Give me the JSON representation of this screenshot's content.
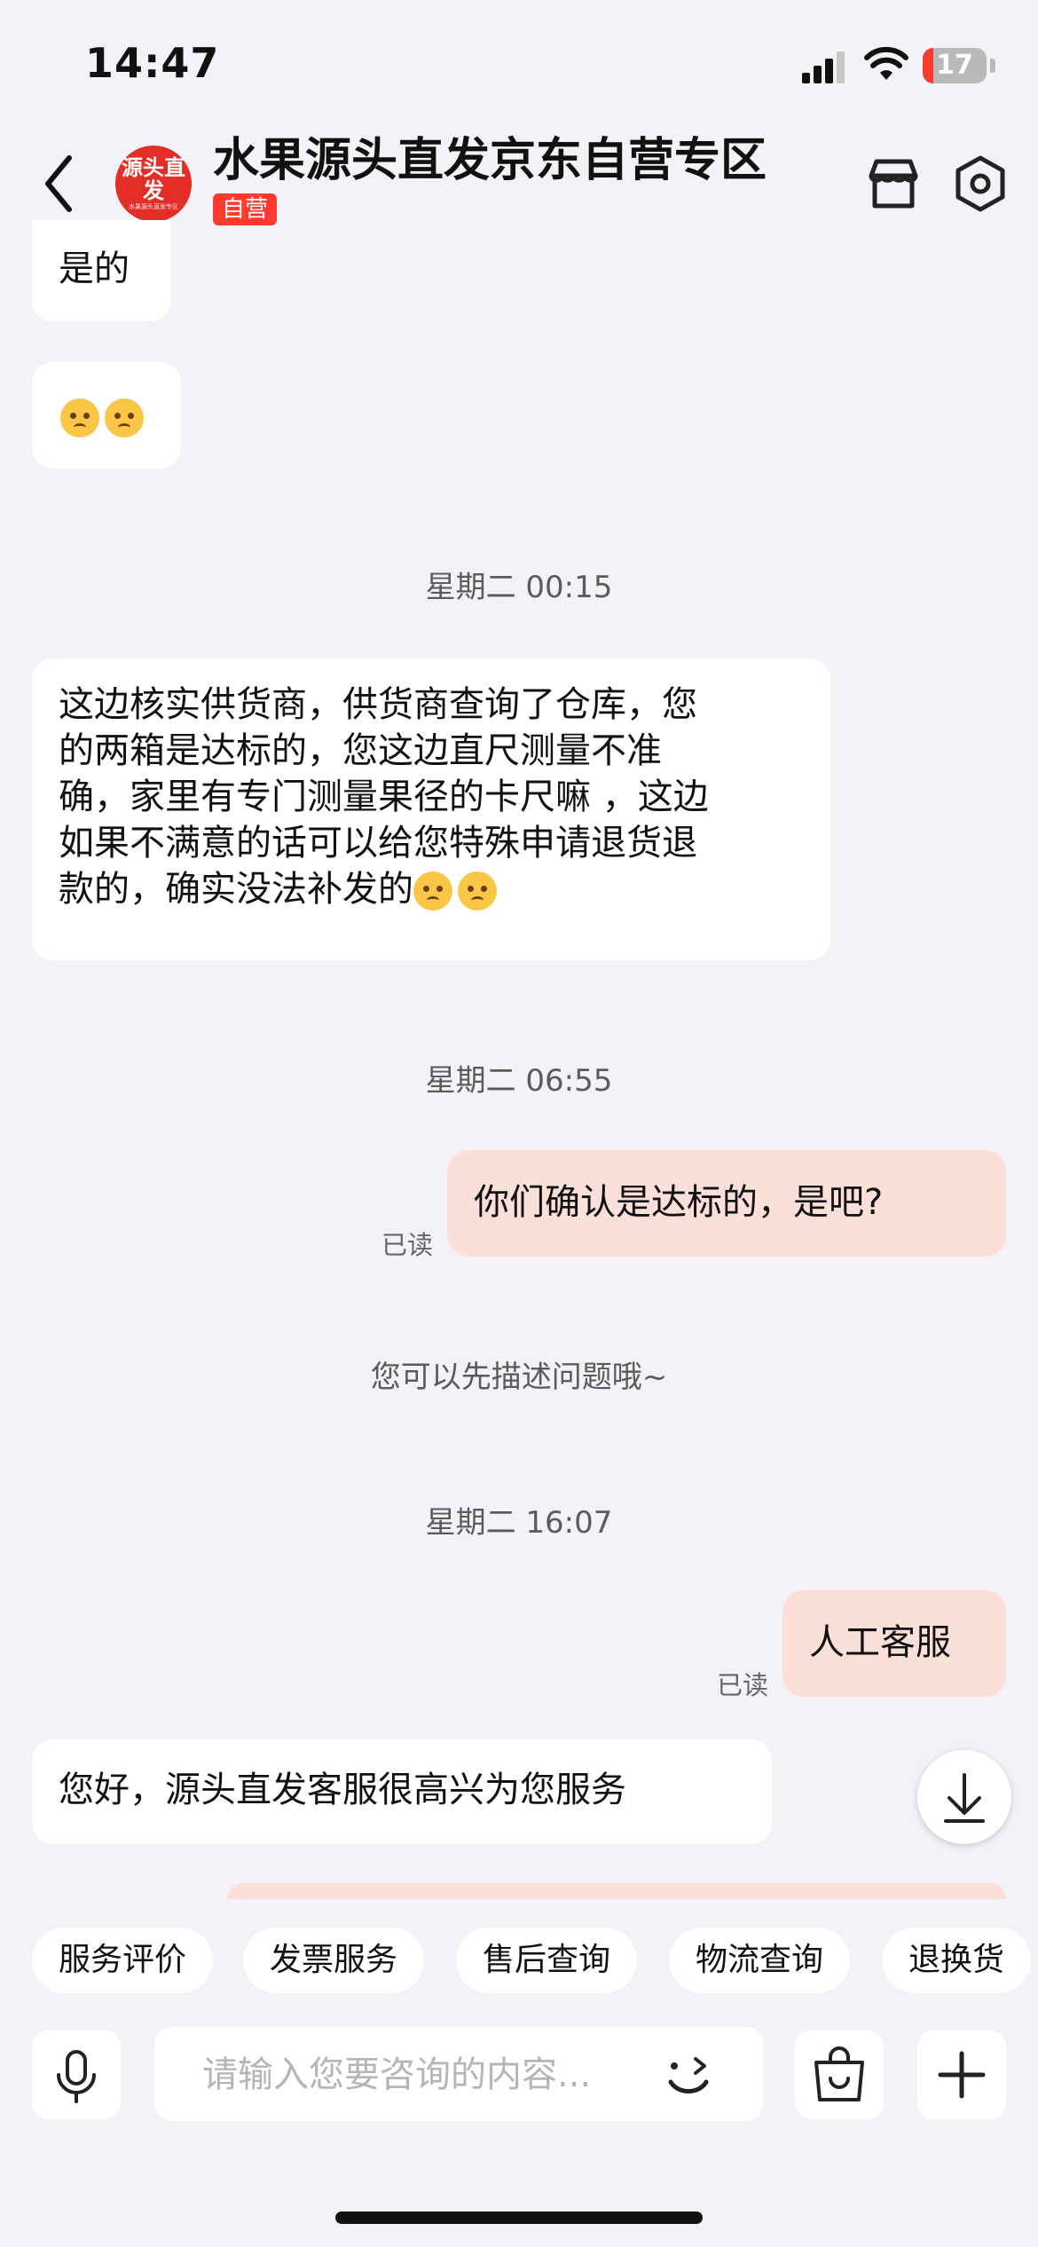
{
  "status_bar": {
    "time": "14:47",
    "battery": "17",
    "battery_level": 0.17
  },
  "header": {
    "title": "水果源头直发京东自营专区",
    "badge": "自营",
    "avatar_text": "源头直发",
    "avatar_subtext": "水果源头直发专区"
  },
  "messages": [
    {
      "type": "received",
      "text": "是的"
    },
    {
      "type": "received",
      "emoji": [
        "pleading-face",
        "persevering-face"
      ]
    },
    {
      "type": "timestamp",
      "text": "星期二 00:15"
    },
    {
      "type": "received",
      "lines": [
        "这边核实供货商，供货商查询了仓库，您",
        "的两箱是达标的，您这边直尺测量不准",
        "确，家里有专门测量果径的卡尺嘛 ，这边",
        "如果不满意的话可以给您特殊申请退货退",
        "款的，确实没法补发的"
      ],
      "emoji": [
        "pleading-face",
        "pleading-face"
      ]
    },
    {
      "type": "timestamp",
      "text": "星期二 06:55"
    },
    {
      "type": "sent",
      "text": "你们确认是达标的，是吧?",
      "status": "已读"
    },
    {
      "type": "system",
      "text": "您可以先描述问题哦~"
    },
    {
      "type": "timestamp",
      "text": "星期二 16:07"
    },
    {
      "type": "sent",
      "text": "人工客服",
      "status": "已读"
    },
    {
      "type": "received",
      "text": "您好，源头直发客服很高兴为您服务"
    }
  ],
  "quick_actions": [
    "服务评价",
    "发票服务",
    "售后查询",
    "物流查询",
    "退换货"
  ],
  "input": {
    "placeholder": "请输入您要咨询的内容..."
  },
  "colors": {
    "accent": "#e52d27",
    "sent_bubble": "#fbe0da",
    "background": "#f2f2f7"
  }
}
